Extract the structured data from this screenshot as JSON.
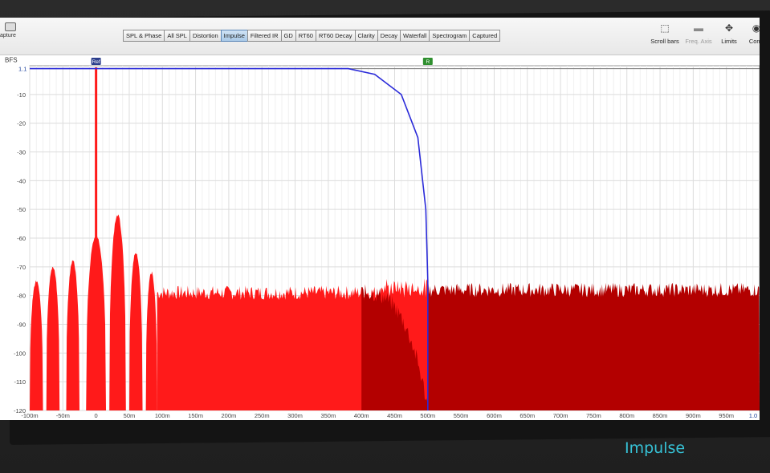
{
  "toolbar": {
    "capture_label": "apture",
    "tabs": [
      "SPL & Phase",
      "All SPL",
      "Distortion",
      "Impulse",
      "Filtered IR",
      "GD",
      "RT60",
      "RT60 Decay",
      "Clarity",
      "Decay",
      "Waterfall",
      "Spectrogram",
      "Captured"
    ],
    "active_tab": "Impulse",
    "scroll_bars_label": "Scroll bars",
    "freq_axis_label": "Freq. Axis",
    "limits_label": "Limits",
    "controls_label": "Contr"
  },
  "caption": "Impulse",
  "chart_data": {
    "type": "area",
    "y_unit_label": "BFS",
    "xlim": [
      -100,
      1000
    ],
    "ylim": [
      -120,
      0
    ],
    "x_tick_labels": [
      "-100m",
      "-50m",
      "0",
      "50m",
      "100m",
      "150m",
      "200m",
      "250m",
      "300m",
      "350m",
      "400m",
      "450m",
      "500m",
      "550m",
      "600m",
      "650m",
      "700m",
      "750m",
      "800m",
      "850m",
      "900m",
      "950m"
    ],
    "x_ticks": [
      -100,
      -50,
      0,
      50,
      100,
      150,
      200,
      250,
      300,
      350,
      400,
      450,
      500,
      550,
      600,
      650,
      700,
      750,
      800,
      850,
      900,
      950
    ],
    "y_tick_labels": [
      "-10",
      "-20",
      "-30",
      "-40",
      "-50",
      "-60",
      "-70",
      "-80",
      "-90",
      "-100",
      "-110",
      "-120"
    ],
    "y_ticks": [
      -10,
      -20,
      -30,
      -40,
      -50,
      -60,
      -70,
      -80,
      -90,
      -100,
      -110,
      -120
    ],
    "y_top_marker": "1.1",
    "x_end_marker": "1.0",
    "cursor_markers": [
      {
        "label": "Ref",
        "x": 0,
        "color": "#2c3e8c"
      },
      {
        "label": "R",
        "x": 500,
        "color": "#2f8f2f"
      }
    ],
    "series": [
      {
        "color": "#ff1a1a",
        "peak": {
          "x": 0,
          "y": 0
        },
        "lobes": [
          {
            "x_from": -100,
            "x_to": -80,
            "y": -75
          },
          {
            "x_from": -75,
            "x_to": -55,
            "y": -70
          },
          {
            "x_from": -45,
            "x_to": -25,
            "y": -68
          },
          {
            "x_from": -15,
            "x_to": 15,
            "y": -59
          },
          {
            "x_from": 20,
            "x_to": 45,
            "y": -52
          },
          {
            "x_from": 50,
            "x_to": 70,
            "y": -65
          },
          {
            "x_from": 75,
            "x_to": 92,
            "y": -72
          }
        ],
        "noise_floor": {
          "x_from": 92,
          "x_to": 500,
          "y": -79
        }
      },
      {
        "color": "#b30000",
        "noise_floor": {
          "x_from": 400,
          "x_to": 1000,
          "y": -78
        }
      },
      {
        "color": "#2b2bd9",
        "window": [
          {
            "x": -100,
            "y": -1
          },
          {
            "x": 380,
            "y": -1
          },
          {
            "x": 420,
            "y": -3
          },
          {
            "x": 460,
            "y": -10
          },
          {
            "x": 485,
            "y": -25
          },
          {
            "x": 497,
            "y": -50
          },
          {
            "x": 500,
            "y": -75
          },
          {
            "x": 500,
            "y": -120
          }
        ]
      }
    ]
  }
}
